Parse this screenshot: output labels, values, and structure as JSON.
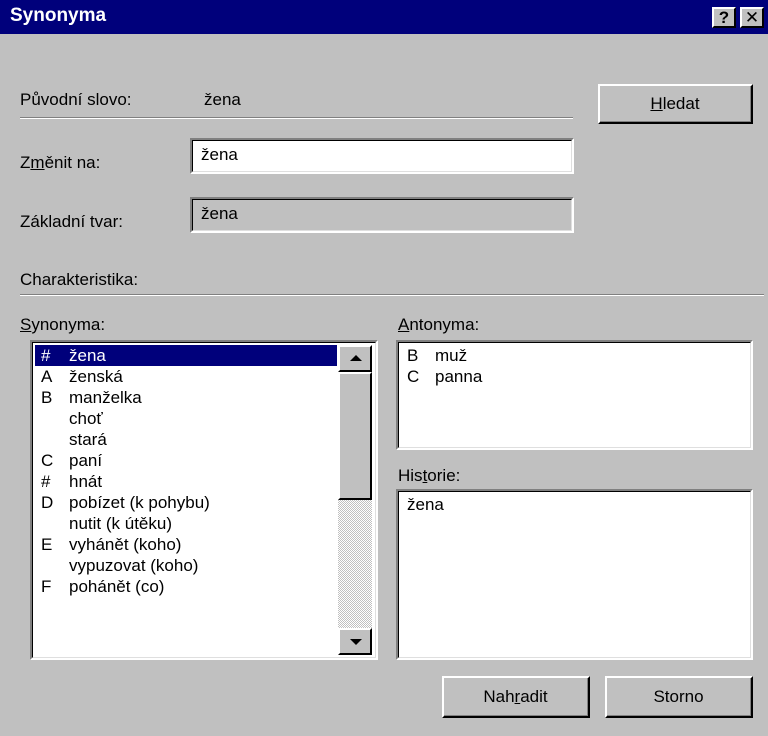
{
  "window": {
    "title": "Synonyma",
    "help_glyph": "?",
    "close_glyph": "✕"
  },
  "original": {
    "label": "Původní slovo:",
    "value": "žena"
  },
  "change_to": {
    "label_prefix": "Z",
    "label_mnemonic": "m",
    "label_suffix": "ěnit na:",
    "value": "žena"
  },
  "base_form": {
    "label": "Základní tvar:",
    "value": "žena"
  },
  "characteristic": {
    "label": "Charakteristika:"
  },
  "buttons": {
    "search_mnemonic": "H",
    "search_rest": "ledat",
    "replace_prefix": "Nah",
    "replace_mnemonic": "r",
    "replace_suffix": "adit",
    "cancel": "Storno"
  },
  "synonyms": {
    "label_mnemonic": "S",
    "label_rest": "ynonyma:",
    "items": [
      {
        "code": "#",
        "word": "žena",
        "selected": true
      },
      {
        "code": "A",
        "word": "ženská"
      },
      {
        "code": "B",
        "word": "manželka"
      },
      {
        "code": "",
        "word": "choť"
      },
      {
        "code": "",
        "word": "stará"
      },
      {
        "code": "C",
        "word": "paní"
      },
      {
        "code": "#",
        "word": "hnát"
      },
      {
        "code": "D",
        "word": "pobízet (k pohybu)"
      },
      {
        "code": "",
        "word": "nutit (k útěku)"
      },
      {
        "code": "E",
        "word": "vyhánět (koho)"
      },
      {
        "code": "",
        "word": "vypuzovat (koho)"
      },
      {
        "code": "F",
        "word": "pohánět (co)"
      }
    ]
  },
  "antonyms": {
    "label_mnemonic": "A",
    "label_rest": "ntonyma:",
    "items": [
      {
        "code": "B",
        "word": "muž"
      },
      {
        "code": "C",
        "word": "panna"
      }
    ]
  },
  "history": {
    "label_prefix": "His",
    "label_mnemonic": "t",
    "label_suffix": "orie:",
    "items": [
      "žena"
    ]
  },
  "colors": {
    "face": "#c0c0c0",
    "title_bar": "#00007b",
    "selection": "#00007b"
  }
}
